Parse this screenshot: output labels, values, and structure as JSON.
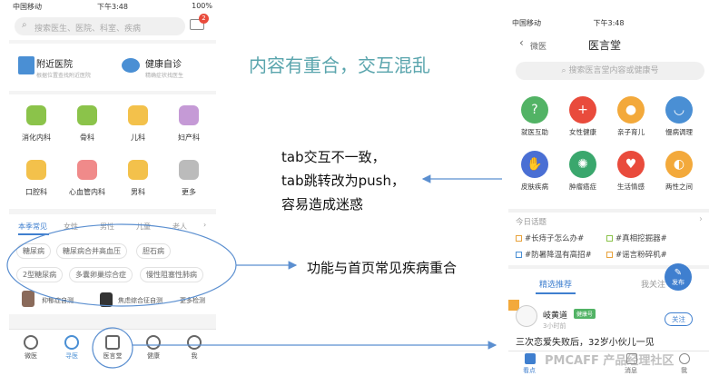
{
  "left_phone": {
    "status": {
      "carrier": "中国移动",
      "time": "下午3:48",
      "battery": "100%"
    },
    "search_placeholder": "搜索医生、医院、科室、疾病",
    "mail_badge": "2",
    "quick_links": [
      {
        "title": "附近医院",
        "subtitle": "根据位置查找附近医院"
      },
      {
        "title": "健康自诊",
        "subtitle": "精确症状找医生"
      }
    ],
    "categories": [
      "消化内科",
      "骨科",
      "儿科",
      "妇产科",
      "口腔科",
      "心血管内科",
      "男科",
      "更多"
    ],
    "tabs": [
      "本季常见",
      "女性",
      "男性",
      "儿童",
      "老人"
    ],
    "disease_tags": [
      "糖尿病",
      "糖尿病合并高血压",
      "胆石病",
      "2型糖尿病",
      "多囊卵巢综合症",
      "慢性阻塞性肺病"
    ],
    "self_tests": [
      "抑郁症自测",
      "焦虑综合征自测",
      "更多检测"
    ],
    "tabbar": [
      "微医",
      "寻医",
      "医言堂",
      "健康",
      "我"
    ]
  },
  "right_phone": {
    "status": {
      "carrier": "中国移动",
      "time": "下午3:48"
    },
    "back_label": "微医",
    "title": "医言堂",
    "search_placeholder": "搜索医言堂内容或健康号",
    "categories": [
      "就医互助",
      "女性健康",
      "亲子育儿",
      "慢病调理",
      "皮肤疾病",
      "肿瘤癌症",
      "生活情感",
      "两性之间"
    ],
    "topics_header": "今日话题",
    "topics": [
      "#长痔子怎么办#",
      "#真相挖掘器#",
      "#防暑降温有高招#",
      "#谣言粉碎机#"
    ],
    "feed_tabs": [
      "精选推荐",
      "我关注"
    ],
    "post": {
      "author": "岐黄道",
      "badge": "健康号",
      "time": "3小时前",
      "follow": "关注",
      "title": "三次恋爱失败后，32岁小伙儿一见"
    },
    "fab": "发布",
    "tabbar": [
      "看点",
      "消息",
      "我"
    ]
  },
  "annotations": {
    "title": "内容有重合，交互混乱",
    "tab_note": [
      "tab交互不一致，",
      "tab跳转改为push，",
      "容易造成迷惑"
    ],
    "overlap_note": "功能与首页常见疾病重合"
  },
  "watermark": "PMCAFF 产品经理社区",
  "colors": {
    "accent_blue": "#4a8fd4",
    "annotation_title": "#5aa5ad",
    "arrow": "#5b8fd0",
    "tab_active": "#3f7fcf"
  }
}
